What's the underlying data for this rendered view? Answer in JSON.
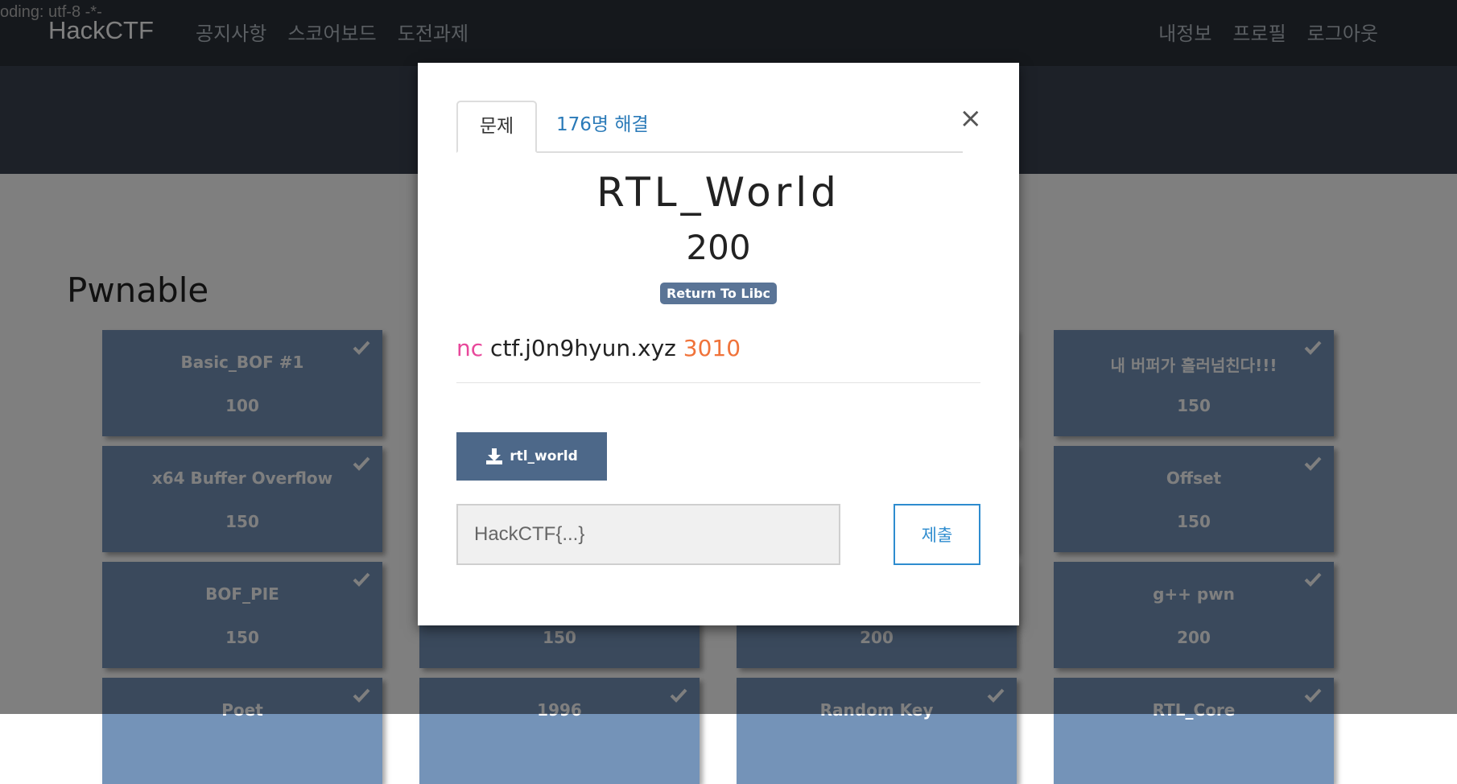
{
  "encoding_note": "oding: utf-8 -*-",
  "navbar": {
    "brand": "HackCTF",
    "left_links": [
      "공지사항",
      "스코어보드",
      "도전과제"
    ],
    "right_links": [
      "내정보",
      "프로필",
      "로그아웃"
    ]
  },
  "section": {
    "title": "Pwnable"
  },
  "cards": [
    {
      "title": "Basic_BOF #1",
      "points": "100",
      "solved": true
    },
    {
      "title": "",
      "points": "",
      "solved": false
    },
    {
      "title": "",
      "points": "",
      "solved": false
    },
    {
      "title": "내 버퍼가 흘러넘친다!!!",
      "points": "150",
      "solved": true
    },
    {
      "title": "x64 Buffer Overflow",
      "points": "150",
      "solved": true
    },
    {
      "title": "",
      "points": "",
      "solved": false
    },
    {
      "title": "",
      "points": "",
      "solved": false
    },
    {
      "title": "Offset",
      "points": "150",
      "solved": true
    },
    {
      "title": "BOF_PIE",
      "points": "150",
      "solved": true
    },
    {
      "title": "",
      "points": "150",
      "solved": false
    },
    {
      "title": "",
      "points": "200",
      "solved": false
    },
    {
      "title": "g++ pwn",
      "points": "200",
      "solved": true
    },
    {
      "title": "Poet",
      "points": "",
      "solved": true
    },
    {
      "title": "1996",
      "points": "",
      "solved": true
    },
    {
      "title": "Random Key",
      "points": "",
      "solved": true
    },
    {
      "title": "RTL_Core",
      "points": "",
      "solved": true
    }
  ],
  "modal": {
    "tabs": {
      "problem": "문제",
      "solved": "176명 해결"
    },
    "close": "×",
    "title": "RTL_World",
    "points": "200",
    "tag": "Return To Libc",
    "connection": {
      "cmd": "nc",
      "host": "ctf.j0n9hyun.xyz",
      "port": "3010"
    },
    "download": {
      "label": "rtl_world",
      "icon": "download-icon"
    },
    "flag_input": {
      "placeholder": "HackCTF{...}",
      "value": ""
    },
    "submit": "제출"
  },
  "colors": {
    "navbar": "#2b3138",
    "card": "#7493b8",
    "tag": "#5a7496",
    "download_button": "#4d6889",
    "submit_border": "#2e8ccf",
    "nc": "#e8489b",
    "port": "#f0733a"
  }
}
